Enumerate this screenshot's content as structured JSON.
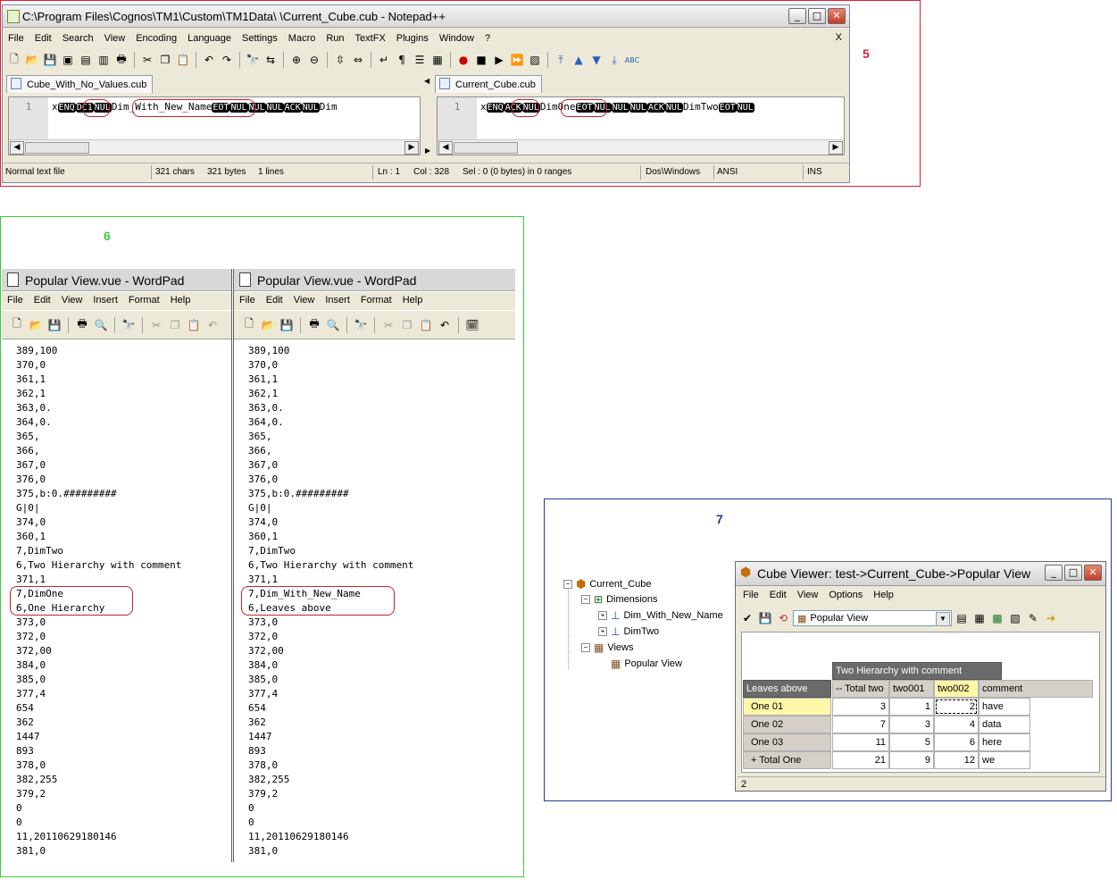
{
  "notepad": {
    "title": "C:\\Program Files\\Cognos\\TM1\\Custom\\TM1Data\\     \\Current_Cube.cub - Notepad++",
    "menu": [
      "File",
      "Edit",
      "Search",
      "View",
      "Encoding",
      "Language",
      "Settings",
      "Macro",
      "Run",
      "TextFX",
      "Plugins",
      "Window",
      "?"
    ],
    "close_x": "X",
    "left_tab": "Cube_With_No_Values.cub",
    "right_tab": "Current_Cube.cub",
    "line_number": "1",
    "left_line": [
      {
        "t": "x"
      },
      {
        "c": "ENQ"
      },
      {
        "c": "DC1"
      },
      {
        "c": "NUL"
      },
      {
        "t": "Dim_With_New_Name"
      },
      {
        "c": "EOT"
      },
      {
        "c": "NUL"
      },
      {
        "c": "NUL"
      },
      {
        "c": "NUL"
      },
      {
        "c": "ACK"
      },
      {
        "c": "NUL"
      },
      {
        "t": "Dim"
      }
    ],
    "right_line": [
      {
        "t": "x"
      },
      {
        "c": "ENQ"
      },
      {
        "c": "ACK"
      },
      {
        "c": "NUL"
      },
      {
        "t": "DimOne"
      },
      {
        "c": "EOT"
      },
      {
        "c": "NUL"
      },
      {
        "c": "NUL"
      },
      {
        "c": "NUL"
      },
      {
        "c": "ACK"
      },
      {
        "c": "NUL"
      },
      {
        "t": "DimTwo"
      },
      {
        "c": "EOT"
      },
      {
        "c": "NUL"
      }
    ],
    "status": {
      "type": "Normal text file",
      "chars": "321 chars",
      "bytes": "321 bytes",
      "lines": "1 lines",
      "ln": "Ln : 1",
      "col": "Col : 328",
      "sel": "Sel : 0 (0 bytes) in 0 ranges",
      "eol": "Dos\\Windows",
      "enc": "ANSI",
      "mode": "INS"
    }
  },
  "labels": {
    "five": "5",
    "six": "6",
    "seven": "7"
  },
  "wordpad": {
    "title": "Popular View.vue - WordPad",
    "menu": [
      "File",
      "Edit",
      "View",
      "Insert",
      "Format",
      "Help"
    ],
    "left_lines": [
      "389,100",
      "370,0",
      "361,1",
      "362,1",
      "363,0.",
      "364,0.",
      "365,",
      "366,",
      "367,0",
      "376,0",
      "375,b:0.#########",
      "G|0|",
      "374,0",
      "360,1",
      "7,DimTwo",
      "6,Two Hierarchy with comment",
      "371,1",
      "7,DimOne",
      "6,One Hierarchy",
      "373,0",
      "372,0",
      "372,00",
      "384,0",
      "385,0",
      "377,4",
      "654",
      "362",
      "1447",
      "893",
      "378,0",
      "382,255",
      "379,2",
      "0",
      "0",
      "11,20110629180146",
      "381,0"
    ],
    "right_lines": [
      "389,100",
      "370,0",
      "361,1",
      "362,1",
      "363,0.",
      "364,0.",
      "365,",
      "366,",
      "367,0",
      "376,0",
      "375,b:0.#########",
      "G|0|",
      "374,0",
      "360,1",
      "7,DimTwo",
      "6,Two Hierarchy with comment",
      "371,1",
      "7,Dim_With_New_Name",
      "6,Leaves above",
      "373,0",
      "372,0",
      "372,00",
      "384,0",
      "385,0",
      "377,4",
      "654",
      "362",
      "1447",
      "893",
      "378,0",
      "382,255",
      "379,2",
      "0",
      "0",
      "11,20110629180146",
      "381,0"
    ]
  },
  "tree": {
    "root": "Current_Cube",
    "dimensions": "Dimensions",
    "dim1": "Dim_With_New_Name",
    "dim2": "DimTwo",
    "views": "Views",
    "view1": "Popular View"
  },
  "cube_viewer": {
    "title": "Cube Viewer: test->Current_Cube->Popular View",
    "menu": [
      "File",
      "Edit",
      "View",
      "Options",
      "Help"
    ],
    "view_select": "Popular View",
    "column_dim_title": "Two Hierarchy with comment",
    "row_dim_title": "Leaves above",
    "col_headers": [
      "-- Total two",
      "two001",
      "two002",
      "comment"
    ],
    "rows": [
      {
        "label": "One 01",
        "values": [
          "3",
          "1",
          "2",
          "have"
        ]
      },
      {
        "label": "One 02",
        "values": [
          "7",
          "3",
          "4",
          "data"
        ]
      },
      {
        "label": "One 03",
        "values": [
          "11",
          "5",
          "6",
          "here"
        ]
      },
      {
        "label": "+ Total One",
        "values": [
          "21",
          "9",
          "12",
          "we"
        ]
      }
    ],
    "status": "2"
  },
  "colors": {
    "red_box": "#e02030",
    "green_box": "#3ec83e",
    "blue_box": "#1f3a9a",
    "highlight": "#c8202a"
  }
}
